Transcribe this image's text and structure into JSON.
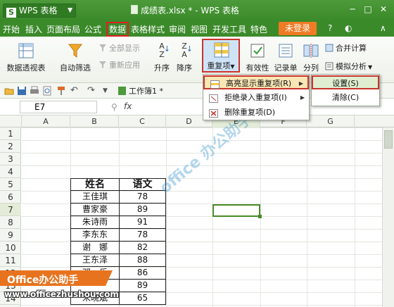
{
  "titlebar": {
    "app_name": "WPS 表格",
    "document_title": "成绩表.xlsx * - WPS 表格"
  },
  "menubar": {
    "items": [
      "开始",
      "插入",
      "页面布局",
      "公式",
      "数据",
      "表格样式",
      "审阅",
      "视图",
      "开发工具",
      "特色"
    ],
    "login_label": "未登录"
  },
  "ribbon": {
    "pivot": "数据透视表",
    "autofilter": "自动筛选",
    "show_all": "全部显示",
    "reapply": "重新应用",
    "sort_asc": "升序",
    "sort_desc": "降序",
    "duplicates": "重复项",
    "validity": "有效性",
    "record": "记录单",
    "split": "分列",
    "merge_calc": "合并计算",
    "simulate": "模拟分析"
  },
  "qat": {
    "workbook_tab": "工作簿1 *"
  },
  "formulabar": {
    "cell_ref": "E7",
    "fx": "fx"
  },
  "columns": [
    "A",
    "B",
    "C",
    "D",
    "E",
    "F",
    "G"
  ],
  "rows": [
    "1",
    "2",
    "3",
    "4",
    "5",
    "6",
    "7",
    "8",
    "9",
    "10",
    "11",
    "12",
    "13",
    "14"
  ],
  "table": {
    "header_name": "姓名",
    "header_score": "语文",
    "rows": [
      {
        "name": "王佳琪",
        "score": "78"
      },
      {
        "name": "曹家豪",
        "score": "89"
      },
      {
        "name": "朱诗雨",
        "score": "91"
      },
      {
        "name": "李东东",
        "score": "78"
      },
      {
        "name": "谢　娜",
        "score": "82"
      },
      {
        "name": "王东泽",
        "score": "88"
      },
      {
        "name": "邓　乐",
        "score": "86"
      },
      {
        "name": "",
        "score": "89"
      },
      {
        "name": "宋晓斌",
        "score": "65"
      }
    ]
  },
  "dropdown": {
    "highlight": "高亮显示重复项(R)",
    "reject": "拒绝录入重复项(I)",
    "delete": "删除重复项(D)"
  },
  "submenu": {
    "set": "设置(S)",
    "clear": "清除(C)"
  },
  "watermark": {
    "logo_text": "Office办公助手",
    "url": "www.officezhushou.com",
    "diag": "office 办公助手"
  },
  "colors": {
    "title_green": "#3b8a2a",
    "highlight_red": "#c8342c",
    "login_orange": "#f07b24"
  }
}
